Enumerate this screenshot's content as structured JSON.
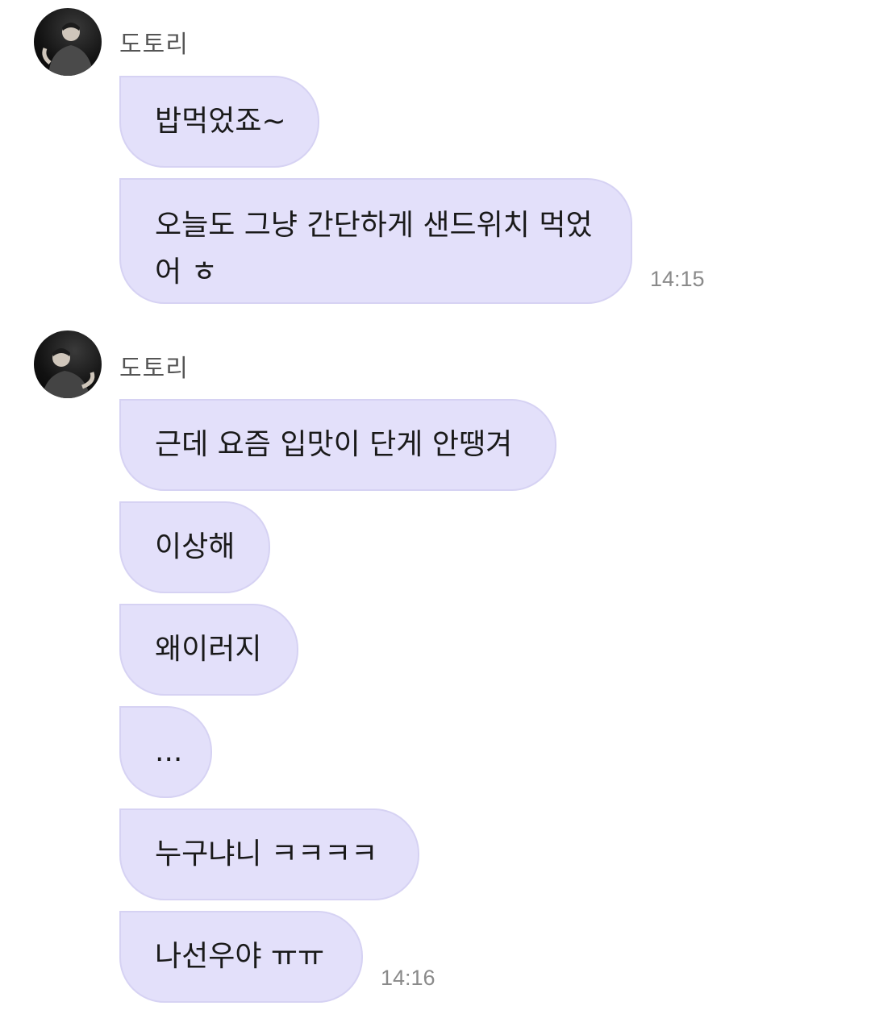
{
  "groups": [
    {
      "sender": "도토리",
      "messages": [
        "밥먹었죠~",
        "오늘도 그냥 간단하게 샌드위치 먹었어 ㅎ"
      ],
      "time": "14:15"
    },
    {
      "sender": "도토리",
      "messages": [
        "근데 요즘 입맛이 단게 안땡겨",
        "이상해",
        "왜이러지",
        "...",
        "누구냐니 ㅋㅋㅋㅋ",
        "나선우야 ㅠㅠ"
      ],
      "time": "14:16"
    }
  ],
  "colors": {
    "bubble": "#e3e0fa",
    "bubble_border": "#d6d2f3",
    "sender_text": "#555555",
    "time_text": "#8a8a8a"
  }
}
